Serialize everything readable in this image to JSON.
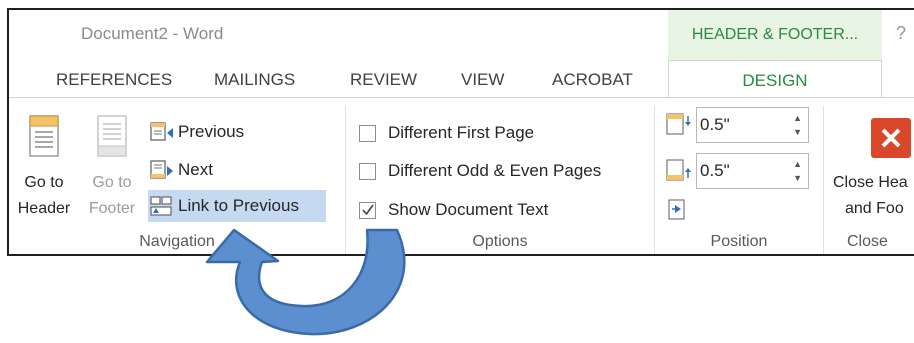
{
  "window": {
    "title": "Document2 - Word",
    "context_tab": "HEADER & FOOTER...",
    "help": "?"
  },
  "tabs": [
    "REFERENCES",
    "MAILINGS",
    "REVIEW",
    "VIEW",
    "ACROBAT"
  ],
  "active_tab": "DESIGN",
  "navigation": {
    "go_to_header": [
      "Go to",
      "Header"
    ],
    "go_to_footer": [
      "Go to",
      "Footer"
    ],
    "previous": "Previous",
    "next": "Next",
    "link_to_previous": "Link to Previous",
    "group_label": "Navigation"
  },
  "options": {
    "different_first_page": {
      "label": "Different First Page",
      "checked": false
    },
    "different_odd_even": {
      "label": "Different Odd & Even Pages",
      "checked": false
    },
    "show_document_text": {
      "label": "Show Document Text",
      "checked": true
    },
    "group_label": "Options"
  },
  "position": {
    "header_from_top": "0.5\"",
    "footer_from_bottom": "0.5\"",
    "group_label": "Position"
  },
  "close": {
    "label": [
      "Close Hea",
      "and Foo"
    ],
    "group_label": "Close"
  },
  "colors": {
    "context_green": "#2b8a3e",
    "context_bg": "#e7f4e4",
    "highlight": "#c5d9f1",
    "close_red": "#d9482b",
    "arrow_fill": "#5b8fcf",
    "arrow_stroke": "#3a6aa8"
  }
}
